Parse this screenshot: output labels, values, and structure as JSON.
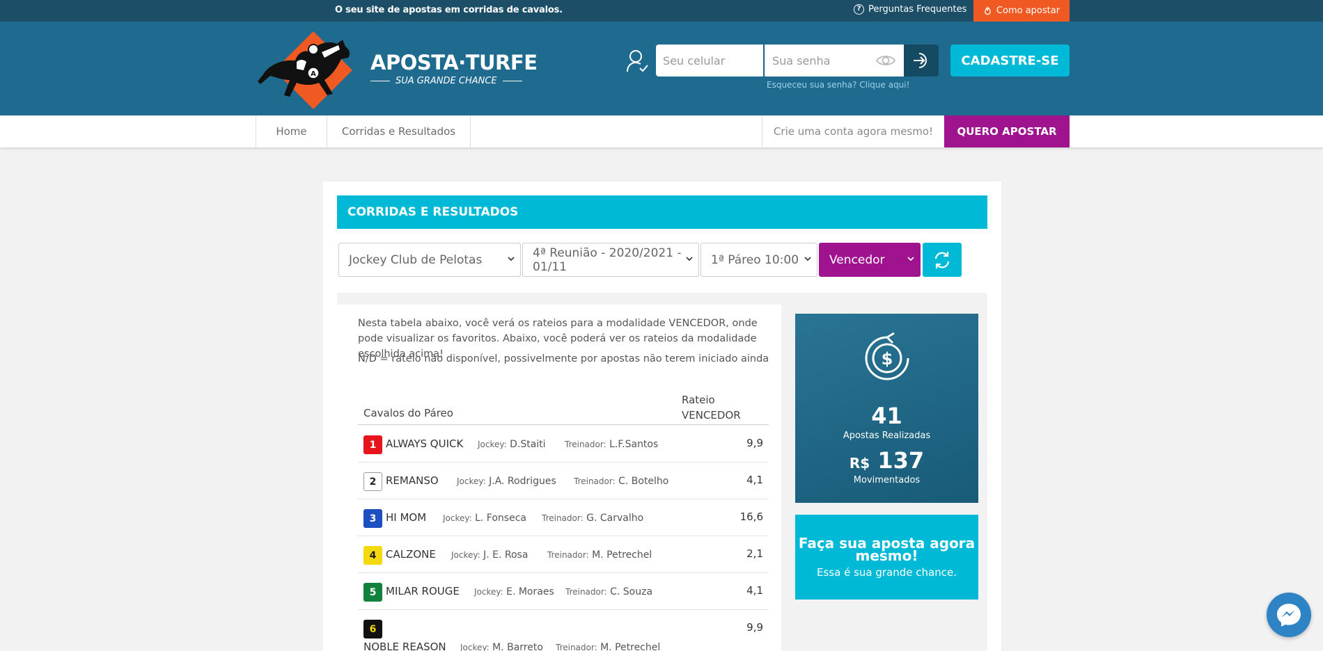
{
  "topbar": {
    "tagline": "O seu site de apostas em corridas de cavalos.",
    "faq": "Perguntas Frequentes",
    "howto": "Como apostar"
  },
  "header": {
    "brand": "APOSTA·TURFE",
    "slogan": "SUA GRANDE CHANCE",
    "phone_placeholder": "Seu celular",
    "password_placeholder": "Sua senha",
    "forgot": "Esqueceu sua senha? Clique aqui!",
    "signup": "CADASTRE-SE"
  },
  "nav": {
    "home": "Home",
    "races": "Corridas e Resultados",
    "create": "Crie uma conta agora mesmo!",
    "want": "QUERO APOSTAR"
  },
  "main": {
    "title": "CORRIDAS E RESULTADOS",
    "filters": {
      "club": "Jockey Club de Pelotas",
      "meeting": "4ª Reunião - 2020/2021 - 01/11",
      "race": "1ª Páreo 10:00",
      "mode": "Vencedor"
    },
    "intro": "Nesta tabela abaixo, você verá os rateios para a modalidade VENCEDOR, onde pode visualizar os favoritos. Abaixo, você poderá ver os rateios da modalidade escolhida acima!",
    "note": "N/D = rateio não disponível, possivelmente por apostas não terem iniciado ainda",
    "col_horses": "Cavalos do Páreo",
    "col_rate_1": "Rateio",
    "col_rate_2": "VENCEDOR",
    "jockey_label": "Jockey:",
    "trainer_label": "Treinador:",
    "horses": [
      {
        "num": "1",
        "name": "ALWAYS QUICK",
        "jockey": "D.Staiti",
        "trainer": "L.F.Santos",
        "rate": "9,9",
        "bg": "#e8141b",
        "fg": "#ffffff"
      },
      {
        "num": "2",
        "name": "REMANSO",
        "jockey": "J.A. Rodrigues",
        "trainer": "C. Botelho",
        "rate": "4,1",
        "bg": "#ffffff",
        "fg": "#222222"
      },
      {
        "num": "3",
        "name": "HI MOM",
        "jockey": "L. Fonseca",
        "trainer": "G. Carvalho",
        "rate": "16,6",
        "bg": "#1c4fbf",
        "fg": "#ffffff"
      },
      {
        "num": "4",
        "name": "CALZONE",
        "jockey": "J. E. Rosa",
        "trainer": "M. Petrechel",
        "rate": "2,1",
        "bg": "#f5d90f",
        "fg": "#222222"
      },
      {
        "num": "5",
        "name": "MILAR ROUGE",
        "jockey": "E. Moraes",
        "trainer": "C. Souza",
        "rate": "4,1",
        "bg": "#12813e",
        "fg": "#ffffff"
      },
      {
        "num": "6",
        "name": "NOBLE REASON",
        "jockey": "M. Barreto",
        "trainer": "M. Petrechel",
        "rate": "9,9",
        "bg": "#111111",
        "fg": "#f5d90f"
      }
    ]
  },
  "stats": {
    "bets": "41",
    "bets_label": "Apostas Realizadas",
    "currency": "R$",
    "moved": "137",
    "moved_label": "Movimentados"
  },
  "cta": {
    "big": "Faça sua aposta agora mesmo!",
    "small": "Essa é sua grande chance."
  },
  "colors": {
    "topbar": "#1d4e68",
    "header": "#1f6a8f",
    "accent": "#00b9d6",
    "orange": "#f05a22",
    "magenta": "#a0138e"
  }
}
